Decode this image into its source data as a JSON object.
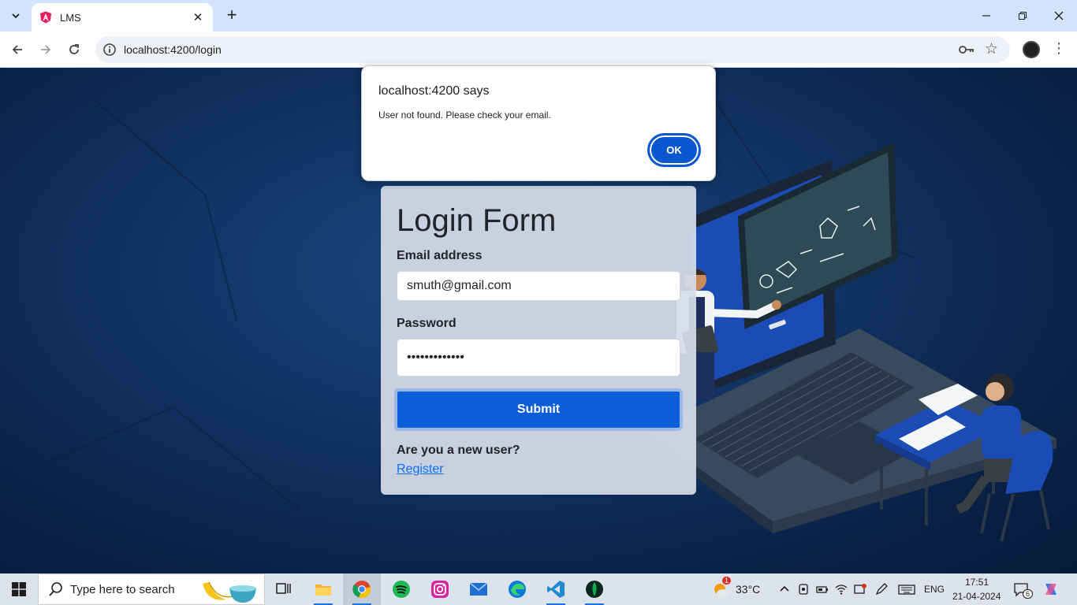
{
  "browser": {
    "tab_title": "LMS",
    "url": "localhost:4200/login",
    "accent": "#d3e3fd"
  },
  "alert": {
    "title": "localhost:4200 says",
    "message": "User not found. Please check your email.",
    "ok_label": "OK"
  },
  "login": {
    "title": "Login Form",
    "email_label": "Email address",
    "email_value": "smuth@gmail.com",
    "password_label": "Password",
    "password_value": "•••••••••••••",
    "submit_label": "Submit",
    "new_user_text": "Are you a new user?",
    "register_label": "Register",
    "button_color": "#0b5ed7"
  },
  "taskbar": {
    "search_placeholder": "Type here to search",
    "weather": "33°C",
    "language": "ENG",
    "time": "17:51",
    "date": "21-04-2024",
    "notification_count": "6",
    "weather_badge": "1"
  }
}
